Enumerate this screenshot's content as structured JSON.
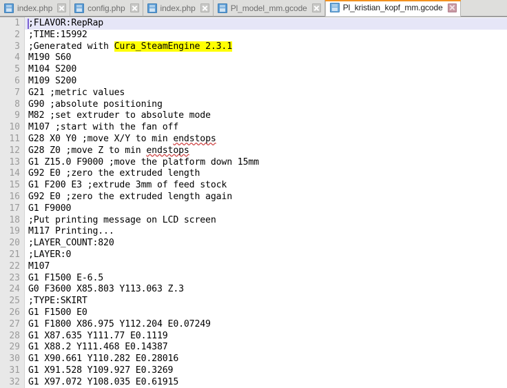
{
  "window": {
    "app": "text-editor",
    "accent_color": "#f3921f",
    "tabbar_bg": "#dededc",
    "gutter_bg": "#e8e8e8",
    "current_line_bg": "#e6e6f7",
    "highlight_color": "#ffff00"
  },
  "tabs": [
    {
      "label": "index.php",
      "icon": "floppy-disk-icon",
      "close_icon": "close-icon",
      "active": false
    },
    {
      "label": "config.php",
      "icon": "floppy-disk-icon",
      "close_icon": "close-icon",
      "active": false
    },
    {
      "label": "index.php",
      "icon": "floppy-disk-icon",
      "close_icon": "close-icon",
      "active": false
    },
    {
      "label": "Pl_model_mm.gcode",
      "icon": "floppy-disk-icon",
      "close_icon": "close-icon",
      "active": false
    },
    {
      "label": "Pl_kristian_kopf_mm.gcode",
      "icon": "floppy-disk-icon",
      "close_icon": "close-icon",
      "active": true
    }
  ],
  "editor": {
    "first_line_number": 1,
    "cursor_line": 1,
    "cursor_column": 1,
    "lines": [
      {
        "n": 1,
        "text": ";FLAVOR:RepRap"
      },
      {
        "n": 2,
        "text": ";TIME:15992"
      },
      {
        "n": 3,
        "text": ";Generated with Cura_SteamEngine 2.3.1",
        "highlight": {
          "text": "Cura_SteamEngine 2.3.1",
          "start": 16
        }
      },
      {
        "n": 4,
        "text": "M190 S60"
      },
      {
        "n": 5,
        "text": "M104 S200"
      },
      {
        "n": 6,
        "text": "M109 S200"
      },
      {
        "n": 7,
        "text": "G21 ;metric values"
      },
      {
        "n": 8,
        "text": "G90 ;absolute positioning"
      },
      {
        "n": 9,
        "text": "M82 ;set extruder to absolute mode"
      },
      {
        "n": 10,
        "text": "M107 ;start with the fan off"
      },
      {
        "n": 11,
        "text": "G28 X0 Y0 ;move X/Y to min endstops",
        "misspelled": "endstops"
      },
      {
        "n": 12,
        "text": "G28 Z0 ;move Z to min endstops",
        "misspelled": "endstops"
      },
      {
        "n": 13,
        "text": "G1 Z15.0 F9000 ;move the platform down 15mm"
      },
      {
        "n": 14,
        "text": "G92 E0 ;zero the extruded length"
      },
      {
        "n": 15,
        "text": "G1 F200 E3 ;extrude 3mm of feed stock"
      },
      {
        "n": 16,
        "text": "G92 E0 ;zero the extruded length again"
      },
      {
        "n": 17,
        "text": "G1 F9000"
      },
      {
        "n": 18,
        "text": ";Put printing message on LCD screen"
      },
      {
        "n": 19,
        "text": "M117 Printing..."
      },
      {
        "n": 20,
        "text": ";LAYER_COUNT:820"
      },
      {
        "n": 21,
        "text": ";LAYER:0"
      },
      {
        "n": 22,
        "text": "M107"
      },
      {
        "n": 23,
        "text": "G1 F1500 E-6.5"
      },
      {
        "n": 24,
        "text": "G0 F3600 X85.803 Y113.063 Z.3"
      },
      {
        "n": 25,
        "text": ";TYPE:SKIRT"
      },
      {
        "n": 26,
        "text": "G1 F1500 E0"
      },
      {
        "n": 27,
        "text": "G1 F1800 X86.975 Y112.204 E0.07249"
      },
      {
        "n": 28,
        "text": "G1 X87.635 Y111.77 E0.1119"
      },
      {
        "n": 29,
        "text": "G1 X88.2 Y111.468 E0.14387"
      },
      {
        "n": 30,
        "text": "G1 X90.661 Y110.282 E0.28016"
      },
      {
        "n": 31,
        "text": "G1 X91.528 Y109.927 E0.3269"
      },
      {
        "n": 32,
        "text": "G1 X97.072 Y108.035 E0.61915"
      }
    ]
  }
}
